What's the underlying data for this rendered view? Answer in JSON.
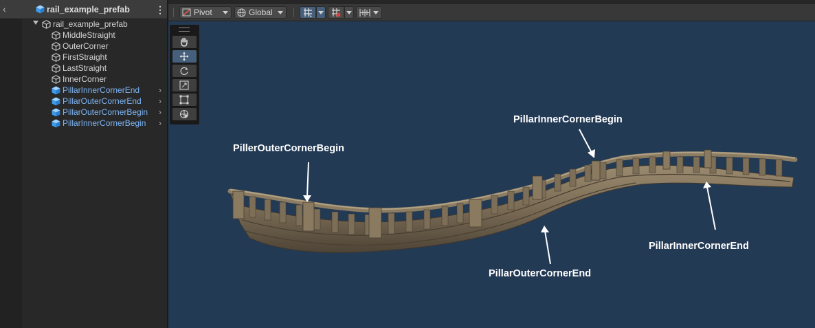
{
  "hierarchy": {
    "prefab_title": "rail_example_prefab",
    "root": "rail_example_prefab",
    "children": [
      {
        "label": "MiddleStraight",
        "kind": "object"
      },
      {
        "label": "OuterCorner",
        "kind": "object"
      },
      {
        "label": "FirstStraight",
        "kind": "object"
      },
      {
        "label": "LastStraight",
        "kind": "object"
      },
      {
        "label": "InnerCorner",
        "kind": "object"
      },
      {
        "label": "PillarInnerCornerEnd",
        "kind": "prefab"
      },
      {
        "label": "PillarOuterCornerEnd",
        "kind": "prefab"
      },
      {
        "label": "PillarOuterCornerBegin",
        "kind": "prefab"
      },
      {
        "label": "PillarInnerCornerBegin",
        "kind": "prefab"
      }
    ]
  },
  "toolbar": {
    "pivot_label": "Pivot",
    "global_label": "Global"
  },
  "tools": [
    "hand-tool",
    "move-tool",
    "rotate-tool",
    "scale-tool",
    "rect-tool",
    "transform-tool"
  ],
  "active_tool": "move-tool",
  "annotations": {
    "outer_begin": "PillerOuterCornerBegin",
    "inner_begin": "PillarInnerCornerBegin",
    "outer_end": "PillarOuterCornerEnd",
    "inner_end": "PillarInnerCornerEnd"
  },
  "colors": {
    "scene_background": "#233a55",
    "prefab_label": "#7db5f5",
    "annotation_text": "#ffffff",
    "active_button": "#46607c"
  }
}
